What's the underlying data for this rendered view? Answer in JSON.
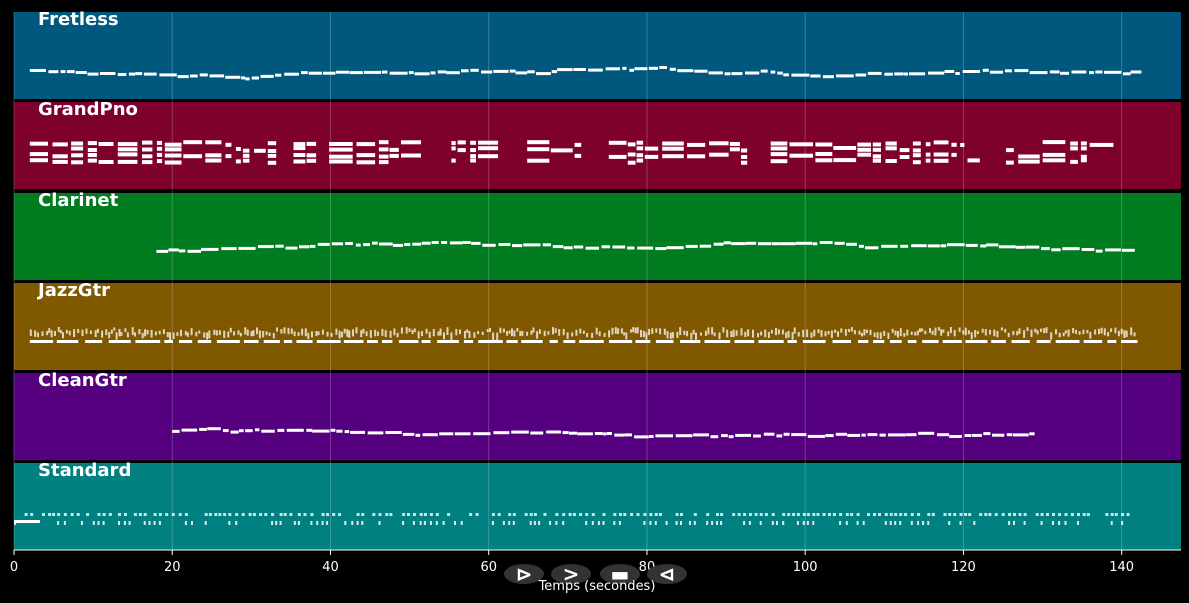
{
  "tracks": [
    {
      "name": "Fretless",
      "color": "#00587f",
      "start": 2,
      "end": 142.5,
      "note_style": "melody"
    },
    {
      "name": "GrandPno",
      "color": "#7e002d",
      "start": 2,
      "end": 141,
      "note_style": "chords"
    },
    {
      "name": "Clarinet",
      "color": "#007b20",
      "start": 18,
      "end": 142,
      "note_style": "melody"
    },
    {
      "name": "JazzGtr",
      "color": "#7f5800",
      "start": 2,
      "end": 142,
      "note_style": "strum"
    },
    {
      "name": "CleanGtr",
      "color": "#55007f",
      "start": 20,
      "end": 129,
      "note_style": "melody"
    },
    {
      "name": "Standard",
      "color": "#008080",
      "start": 0,
      "end": 141,
      "note_style": "drums"
    }
  ],
  "x_axis": {
    "label": "Temps (secondes)",
    "range": [
      0,
      147.5
    ],
    "ticks": [
      "0",
      "20",
      "40",
      "60",
      "80",
      "100",
      "120",
      "140"
    ]
  },
  "controls": [
    {
      "name": "play-icon",
      "glyph": "⊳"
    },
    {
      "name": "forward-icon",
      "glyph": ">"
    },
    {
      "name": "stop-icon",
      "glyph": "▬"
    },
    {
      "name": "rewind-icon",
      "glyph": "⊲"
    }
  ],
  "colors": {
    "background": "#000000",
    "grid": "#ffffff",
    "notes": "#ffffff"
  }
}
